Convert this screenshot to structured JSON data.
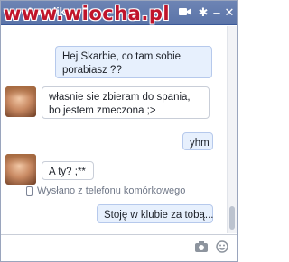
{
  "window": {
    "contact_name": "Angelika",
    "watermark": "www.wiocha.pl",
    "icons": [
      "video-camera-icon",
      "gear-icon",
      "minimize-icon",
      "close-icon"
    ]
  },
  "messages": [
    {
      "direction": "outgoing",
      "text": "Hej Skarbie, co tam sobie porabiasz ??"
    },
    {
      "direction": "incoming",
      "text": "własnie sie zbieram do spania, bo jestem zmeczona ;>"
    },
    {
      "direction": "outgoing",
      "text": "yhm"
    },
    {
      "direction": "incoming",
      "text": "A ty? ;**"
    },
    {
      "direction": "outgoing",
      "text": "Stoję w klubie za tobą..."
    }
  ],
  "sent_from_note": "Wysłano z telefonu komórkowego",
  "composer": {
    "value": "",
    "icons": [
      "camera-icon",
      "emoji-icon"
    ]
  }
}
